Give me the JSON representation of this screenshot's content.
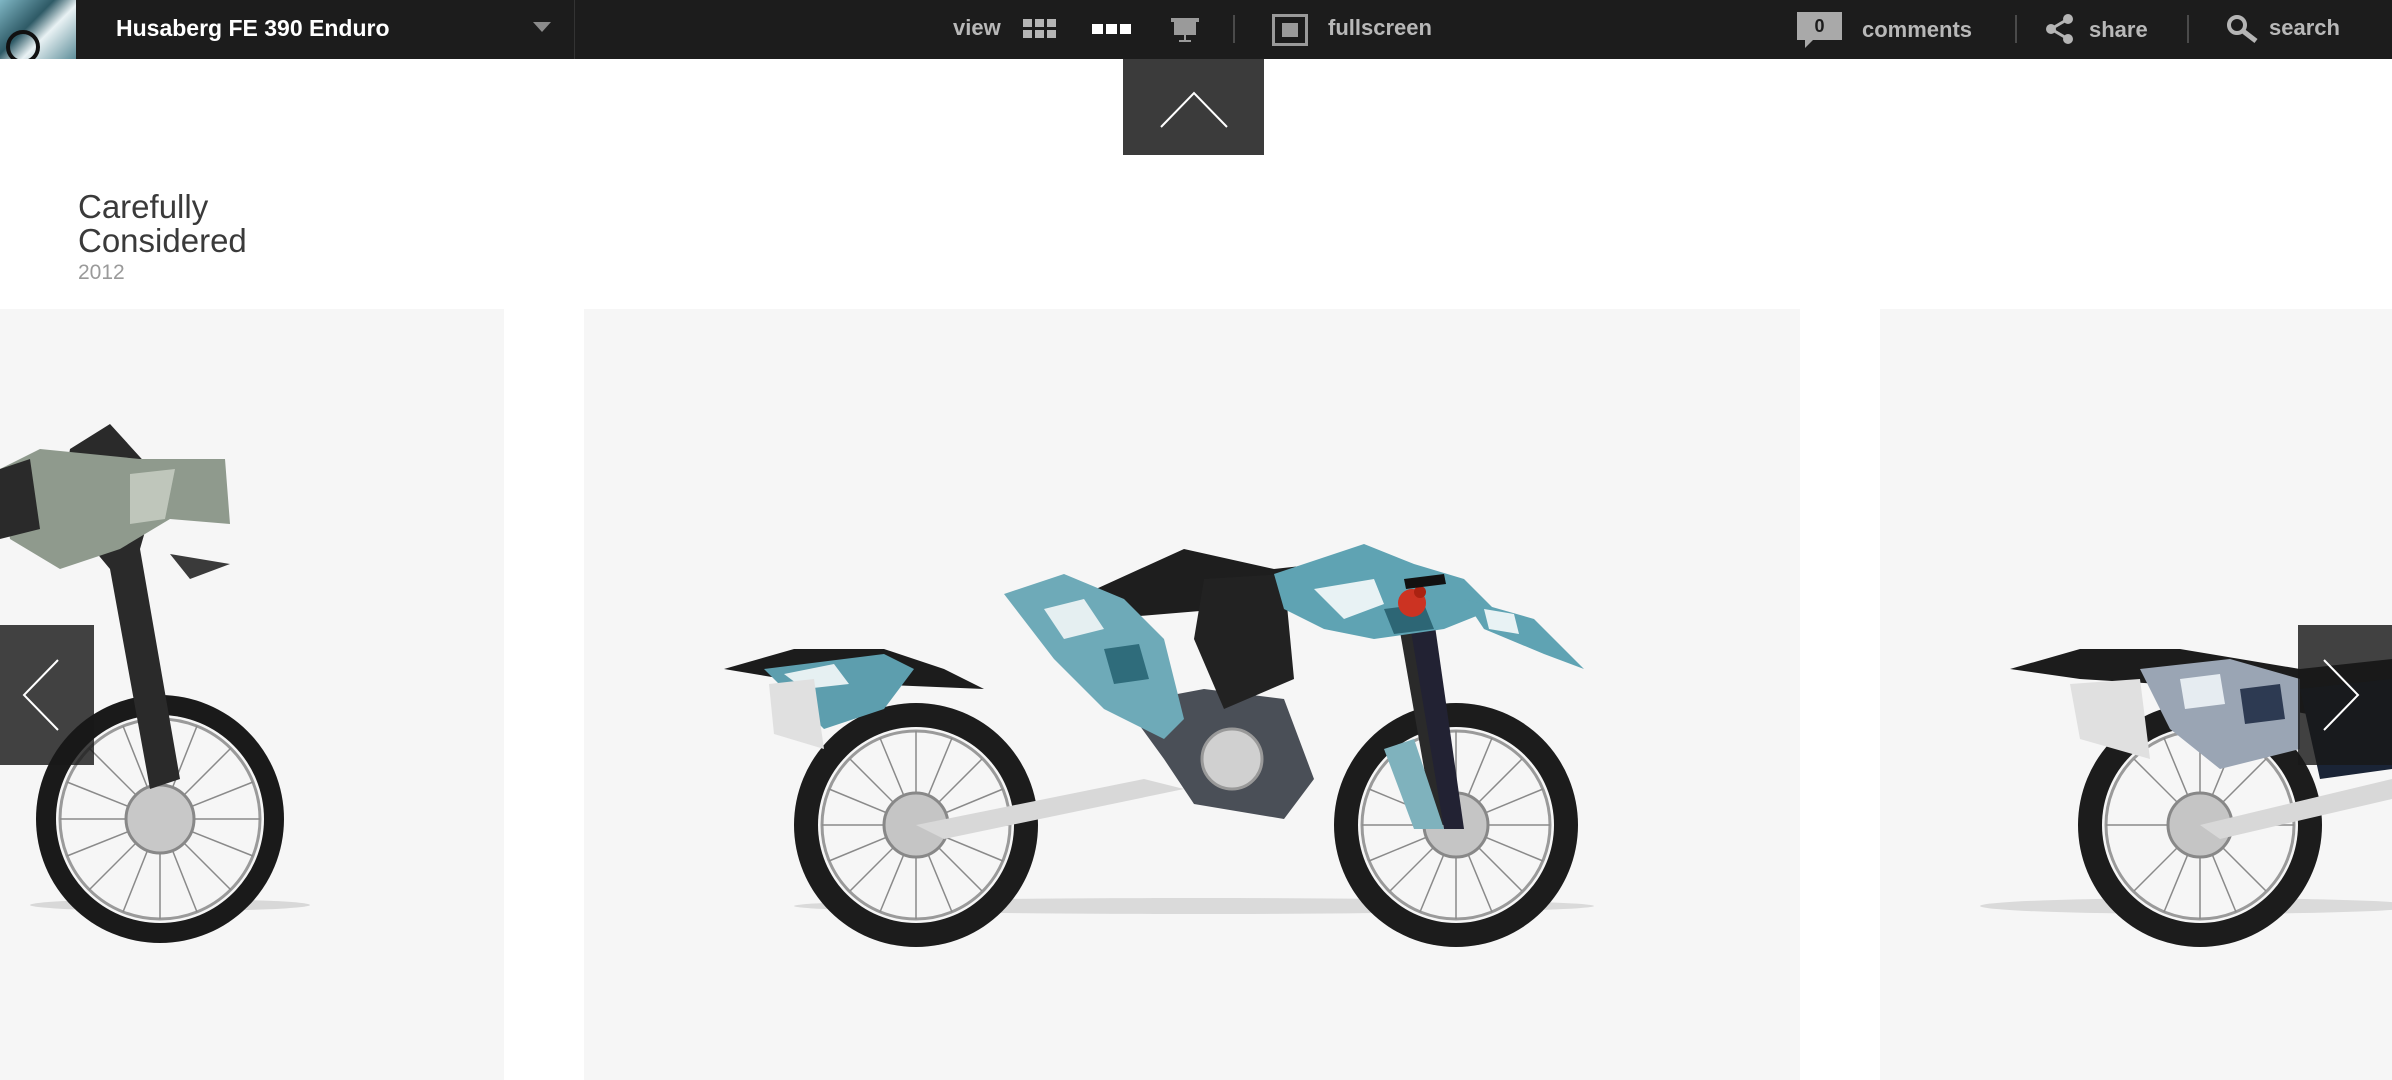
{
  "header": {
    "project_title": "Husaberg FE 390 Enduro",
    "view_label": "view",
    "fullscreen_label": "fullscreen",
    "comments_count": "0",
    "comments_label": "comments",
    "share_label": "share",
    "search_label": "search",
    "colors": {
      "bar_bg": "#1c1c1c",
      "text": "#b8b8b8",
      "title": "#ffffff"
    },
    "icons": [
      "project-thumbnail",
      "chevron-down-icon",
      "grid-view-icon",
      "row-view-icon",
      "presentation-view-icon",
      "fullscreen-icon",
      "comment-bubble-icon",
      "share-icon",
      "search-icon"
    ]
  },
  "project": {
    "title_line1": "Carefully",
    "title_line2": "Considered",
    "year": "2012"
  },
  "gallery": {
    "slides": [
      {
        "name": "motorcycle-image-previous",
        "colorway": "grey digital camo"
      },
      {
        "name": "motorcycle-image-current",
        "colorway": "teal digital camo"
      },
      {
        "name": "motorcycle-image-next",
        "colorway": "navy digital camo"
      }
    ],
    "icons": [
      "chevron-up-icon",
      "chevron-left-icon",
      "chevron-right-icon"
    ],
    "slide_bg": "#f6f6f6"
  }
}
